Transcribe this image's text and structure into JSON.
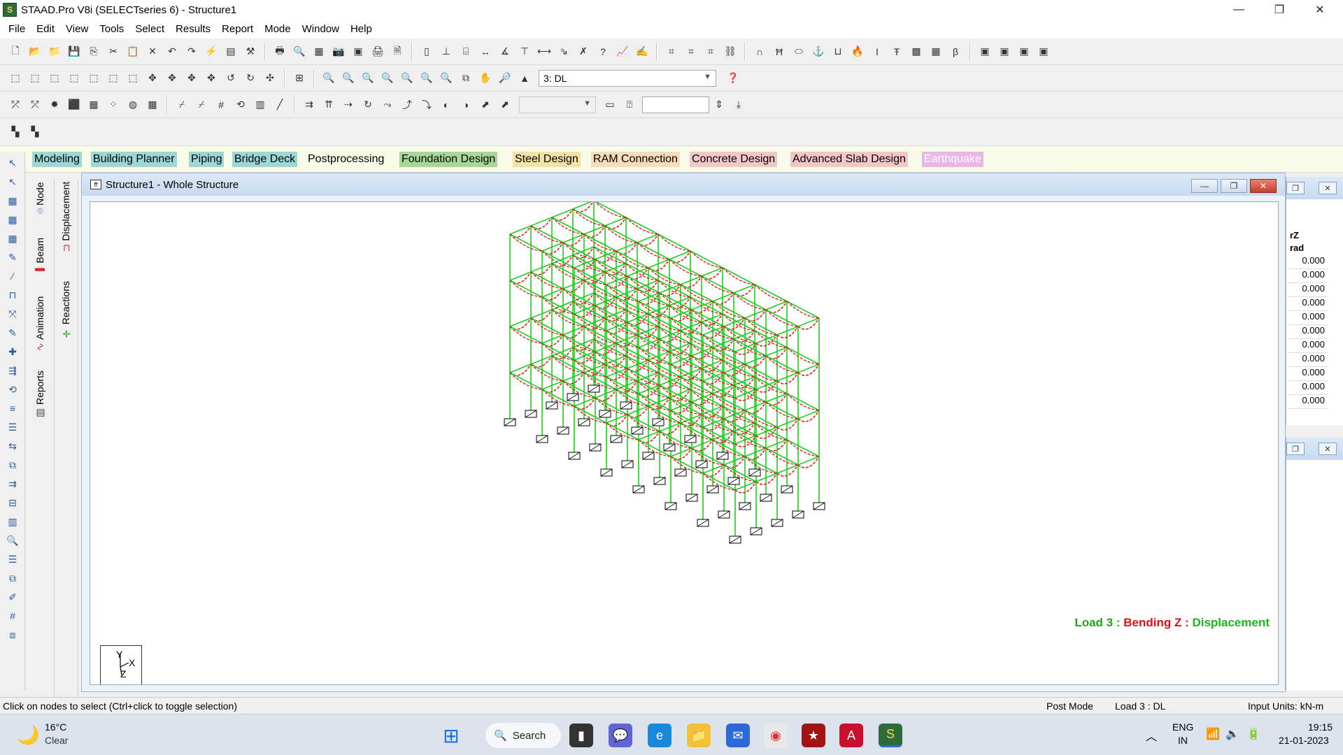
{
  "window": {
    "title": "STAAD.Pro V8i (SELECTseries 6) - Structure1",
    "controls": [
      "—",
      "❐",
      "✕"
    ]
  },
  "menu": [
    "File",
    "Edit",
    "View",
    "Tools",
    "Select",
    "Results",
    "Report",
    "Mode",
    "Window",
    "Help"
  ],
  "toolbar": {
    "load_case_selected": "3: DL"
  },
  "page_tabs": [
    {
      "label": "Modeling",
      "color": "#9dd7d6"
    },
    {
      "label": "Building Planner",
      "color": "#9dd7d6"
    },
    {
      "label": "Piping",
      "color": "#9dd7d6"
    },
    {
      "label": "Bridge Deck",
      "color": "#9dd7d6"
    },
    {
      "label": "Postprocessing",
      "color": "#f8fbe8"
    },
    {
      "label": "Foundation Design",
      "color": "#a8d898"
    },
    {
      "label": "Steel Design",
      "color": "#f2e2a6"
    },
    {
      "label": "RAM Connection",
      "color": "#f6dcb8"
    },
    {
      "label": "Concrete Design",
      "color": "#f1c7c7"
    },
    {
      "label": "Advanced Slab Design",
      "color": "#f1c7c7"
    },
    {
      "label": "Earthquake",
      "color": "#e9b7e6"
    }
  ],
  "side_tabs": {
    "node": "Node",
    "beam": "Beam",
    "animation": "Animation",
    "reports": "Reports",
    "displacement": "Displacement",
    "reactions": "Reactions"
  },
  "viewport": {
    "title": "Structure1 - Whole Structure",
    "load_label_prefix": "Load 3 : ",
    "load_label_middle": "Bending Z : ",
    "load_label_suffix": "Displacement",
    "axis_labels": {
      "y": "Y",
      "x": "X",
      "z": "Z"
    },
    "colors": {
      "frame": "#22cc22",
      "deflected": "#e02020",
      "prefix": "#1aa81a",
      "middle": "#e01010",
      "suffix": "#1ab81a"
    }
  },
  "results_table": {
    "header_1": "rZ",
    "header_2": "rad",
    "values": [
      "0.000",
      "0.000",
      "0.000",
      "0.000",
      "0.000",
      "0.000",
      "0.000",
      "0.000",
      "0.000",
      "0.000",
      "0.000"
    ]
  },
  "status": {
    "hint": "Click on nodes to select (Ctrl+click to toggle selection)",
    "mode": "Post Mode",
    "load": "Load 3 : DL",
    "units": "Input Units:   kN-m"
  },
  "taskbar": {
    "weather_temp": "16°C",
    "weather_cond": "Clear",
    "search_label": "Search",
    "lang_1": "ENG",
    "lang_2": "IN",
    "time": "19:15",
    "date": "21-01-2023"
  }
}
